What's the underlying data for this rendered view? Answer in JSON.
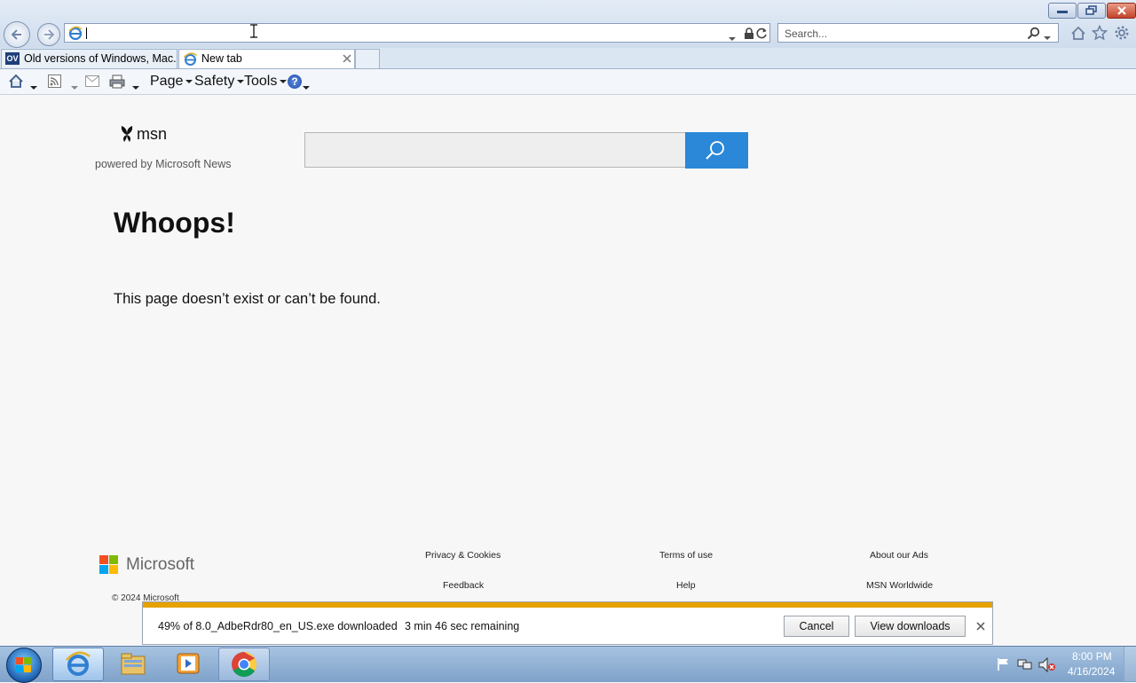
{
  "browser": {
    "address_value": "",
    "search_placeholder": "Search...",
    "tabs": [
      {
        "label": "Old versions of Windows, Mac...",
        "badge": "OV"
      },
      {
        "label": "New tab"
      }
    ],
    "command_bar": {
      "page_label": "Page",
      "safety_label": "Safety",
      "tools_label": "Tools"
    }
  },
  "msn": {
    "logo_text": "msn",
    "tagline": "powered by Microsoft News"
  },
  "content": {
    "heading": "Whoops!",
    "message": "This page doesn’t exist or can’t be found."
  },
  "footer": {
    "brand": "Microsoft",
    "copyright": "© 2024 Microsoft",
    "links": {
      "privacy": "Privacy & Cookies",
      "terms": "Terms of use",
      "ads": "About our Ads",
      "feedback": "Feedback",
      "help": "Help",
      "worldwide": "MSN Worldwide"
    }
  },
  "download": {
    "status": "49% of 8.0_AdbeRdr80_en_US.exe downloaded",
    "remaining": "3 min 46 sec remaining",
    "progress_percent": 49,
    "cancel_label": "Cancel",
    "view_label": "View downloads"
  },
  "taskbar": {
    "time": "8:00 PM",
    "date": "4/16/2024"
  },
  "colors": {
    "msn_search_button": "#2b88d8",
    "download_progress": "#e5a200",
    "ms_red": "#f25022",
    "ms_green": "#7fba00",
    "ms_blue": "#00a4ef",
    "ms_yellow": "#ffb900"
  }
}
